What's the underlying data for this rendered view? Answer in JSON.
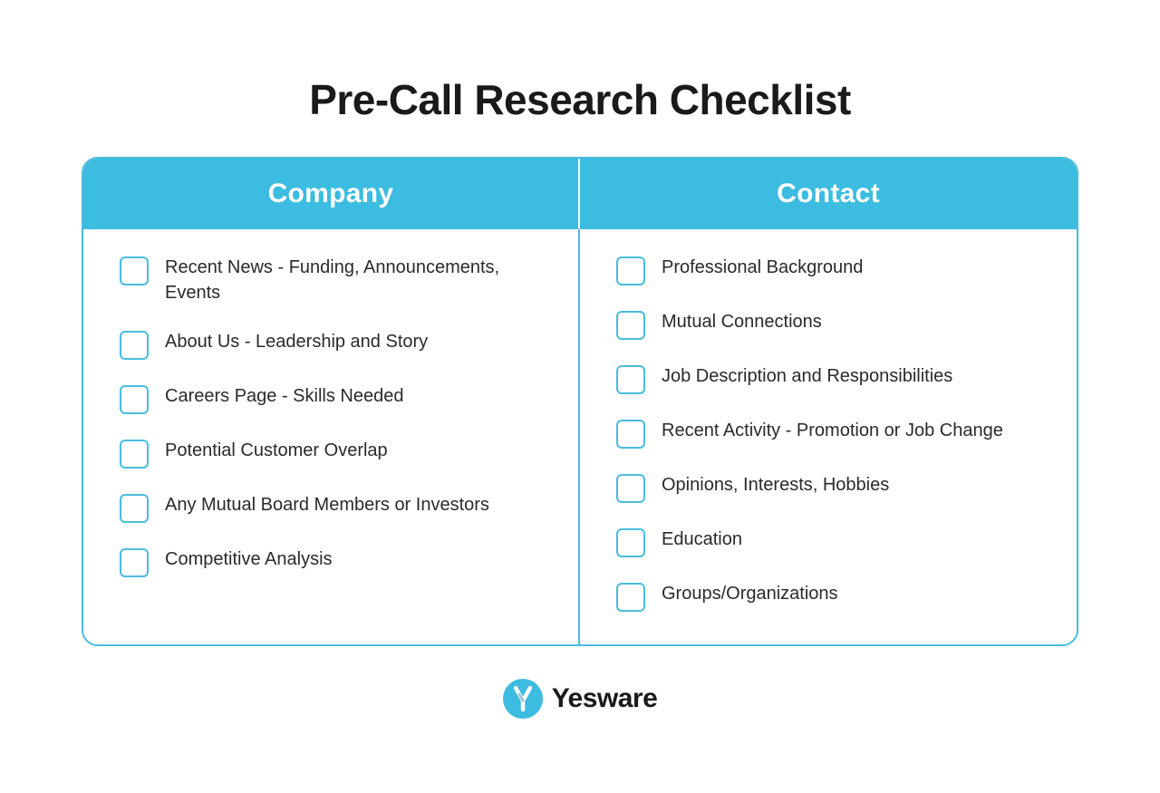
{
  "title": "Pre-Call Research Checklist",
  "colors": {
    "header_bg": "#3bbce0",
    "border": "#4abcde",
    "text_dark": "#1a1a1a",
    "text_body": "#2a2a2a",
    "white": "#ffffff"
  },
  "columns": {
    "company": {
      "header": "Company",
      "items": [
        "Recent News - Funding, Announcements, Events",
        "About Us - Leadership and Story",
        "Careers Page - Skills Needed",
        "Potential Customer Overlap",
        "Any Mutual Board Members or Investors",
        "Competitive Analysis"
      ]
    },
    "contact": {
      "header": "Contact",
      "items": [
        "Professional Background",
        "Mutual Connections",
        "Job Description and Responsibilities",
        "Recent Activity - Promotion or Job Change",
        "Opinions, Interests, Hobbies",
        "Education",
        "Groups/Organizations"
      ]
    }
  },
  "footer": {
    "brand_name": "Yesware"
  }
}
